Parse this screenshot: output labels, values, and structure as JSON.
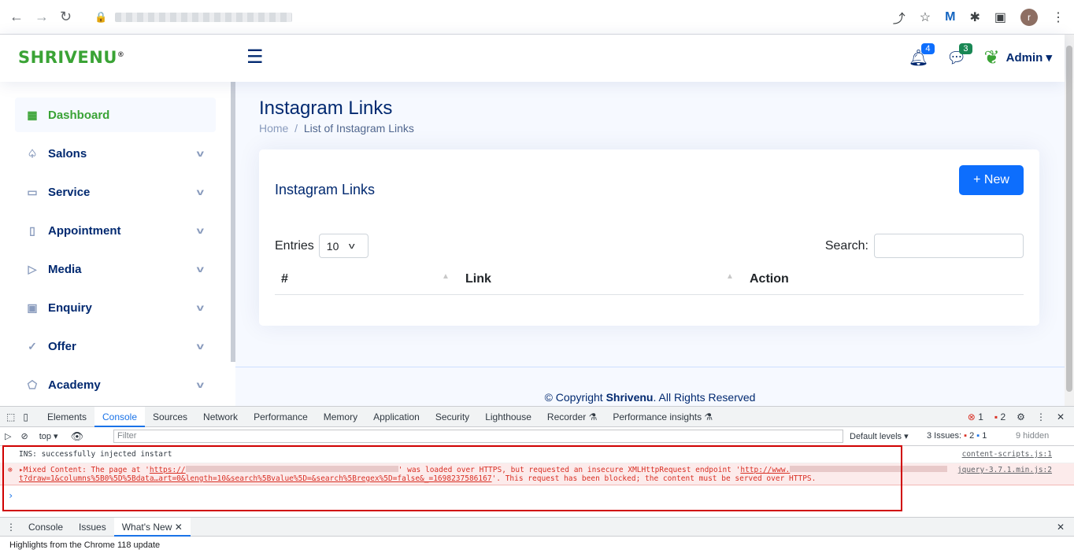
{
  "browser": {
    "back": "←",
    "forward": "→",
    "reload": "↻",
    "avatar": "r"
  },
  "header": {
    "logo": "SHRIVENU",
    "logo_mark": "®",
    "notif_count": "4",
    "msg_count": "3",
    "user": "Admin"
  },
  "sidebar": {
    "items": [
      {
        "label": "Dashboard",
        "icon": "grid-icon",
        "glyph": "▦"
      },
      {
        "label": "Salons",
        "icon": "spade-icon",
        "glyph": "♤"
      },
      {
        "label": "Service",
        "icon": "card-icon",
        "glyph": "▭"
      },
      {
        "label": "Appointment",
        "icon": "clipboard-icon",
        "glyph": "▯"
      },
      {
        "label": "Media",
        "icon": "file-play-icon",
        "glyph": "▷"
      },
      {
        "label": "Enquiry",
        "icon": "person-badge-icon",
        "glyph": "▣"
      },
      {
        "label": "Offer",
        "icon": "patch-check-icon",
        "glyph": "✓"
      },
      {
        "label": "Academy",
        "icon": "pentagon-icon",
        "glyph": "⬠"
      }
    ]
  },
  "page": {
    "title": "Instagram Links",
    "breadcrumb_home": "Home",
    "breadcrumb_sep": "/",
    "breadcrumb_current": "List of Instagram Links"
  },
  "card": {
    "title": "Instagram Links",
    "new_label": "+ New",
    "entries_label": "Entries",
    "entries_value": "10",
    "search_label": "Search:",
    "columns": [
      "#",
      "Link",
      "Action"
    ]
  },
  "footer": {
    "prefix": "© Copyright ",
    "brand": "Shrivenu",
    "suffix": ". All Rights Reserved"
  },
  "devtools": {
    "tabs": [
      "Elements",
      "Console",
      "Sources",
      "Network",
      "Performance",
      "Memory",
      "Application",
      "Security",
      "Lighthouse",
      "Recorder ⚗",
      "Performance insights ⚗"
    ],
    "errors": "1",
    "warnings": "2",
    "context": "top",
    "filter_placeholder": "Filter",
    "levels": "Default levels ▾",
    "issues": "3 Issues:",
    "issues_err": "2",
    "issues_info": "1",
    "hidden": "9 hidden",
    "log1": "INS: successfully injected instart",
    "log1_src": "content-scripts.js:1",
    "log2_a": "Mixed Content: The page at '",
    "log2_url": "https://",
    "log2_b": "' was loaded over HTTPS, but requested an insecure XMLHttpRequest endpoint '",
    "log2_url2": "http://www.",
    "log2_c": "t?draw=1&columns%5B0%5D%5Bdata…art=0&length=10&search%5Bvalue%5D=&search%5Bregex%5D=false&_=1698237586167",
    "log2_d": "'. This request has been blocked; the content must be served over HTTPS.",
    "log2_src": "jquery-3.7.1.min.js:2",
    "prompt": "›",
    "drawer_tabs": [
      "Console",
      "Issues",
      "What's New"
    ],
    "drawer_text": "Highlights from the Chrome 118 update"
  }
}
